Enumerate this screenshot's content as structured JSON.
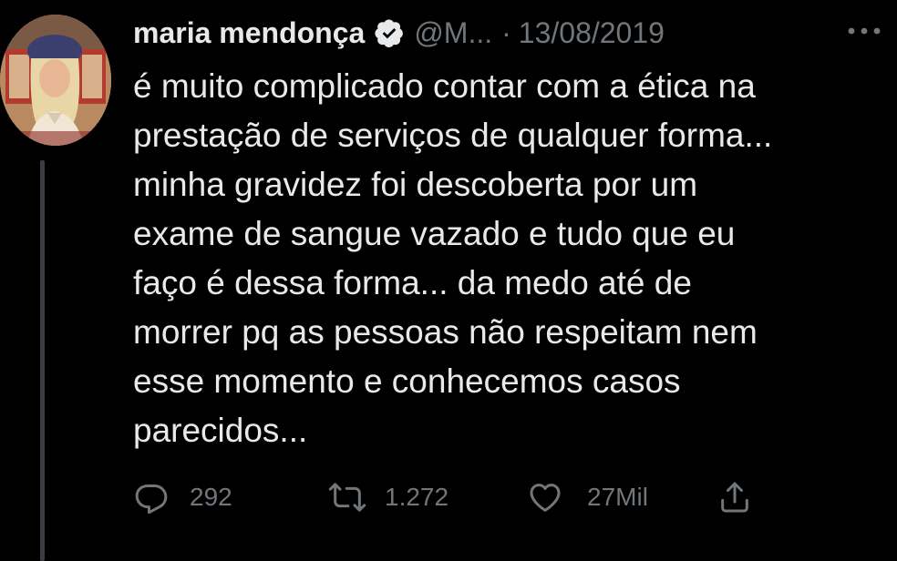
{
  "tweet": {
    "author": {
      "display_name": "maria mendonça",
      "verified": true,
      "handle": "@M...",
      "avatar_icon": "avatar-photo"
    },
    "separator": "·",
    "date": "13/08/2019",
    "more_icon": "more-horizontal-icon",
    "text_lines": [
      "é muito complicado contar com a ética na",
      "prestação de serviços de qualquer forma...",
      "minha gravidez foi descoberta por um",
      "exame de sangue vazado e tudo que eu",
      "faço é dessa forma... da medo até de",
      "morrer pq as pessoas não respeitam nem",
      "esse momento e conhecemos casos",
      "parecidos..."
    ],
    "actions": {
      "reply": {
        "icon": "reply-icon",
        "count": "292"
      },
      "retweet": {
        "icon": "retweet-icon",
        "count": "1.272"
      },
      "like": {
        "icon": "heart-icon",
        "count": "27Mil"
      },
      "share": {
        "icon": "share-icon"
      }
    }
  },
  "colors": {
    "background": "#000000",
    "primary_text": "#e7e9ea",
    "secondary_text": "#71767b",
    "thread_line": "#3a3d41"
  }
}
